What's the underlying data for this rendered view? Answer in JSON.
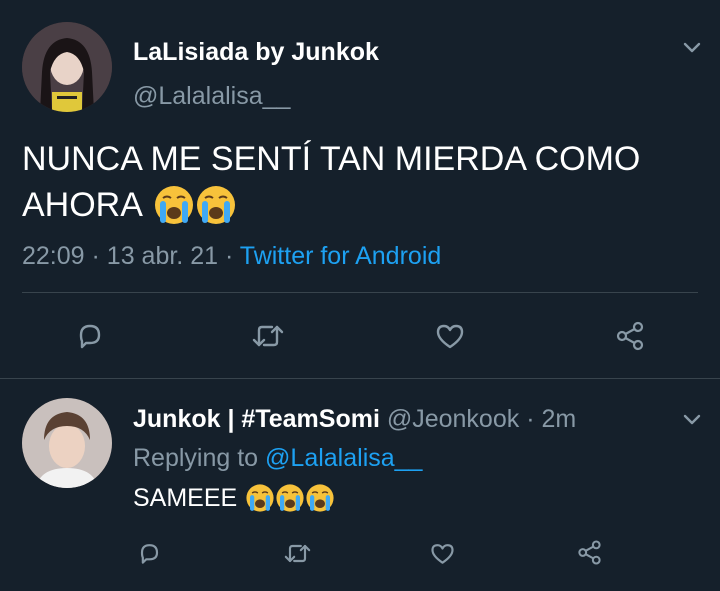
{
  "main_tweet": {
    "display_name": "LaLisiada by Junkok",
    "handle": "@Lalalalisa__",
    "text_line1": "NUNCA ME SENTÍ TAN MIERDA COMO",
    "text_line2": "AHORA",
    "time": "22:09",
    "sep1": "·",
    "date": "13 abr. 21",
    "sep2": "·",
    "source": "Twitter for Android",
    "emojis": [
      "loudly-crying-face",
      "loudly-crying-face"
    ]
  },
  "reply": {
    "display_name": "Junkok | #TeamSomi",
    "handle": "@Jeonkook",
    "sep": "·",
    "age": "2m",
    "replying_prefix": "Replying to",
    "replying_handle": "@Lalalalisa__",
    "text": "SAMEEE",
    "emojis": [
      "loudly-crying-face",
      "loudly-crying-face",
      "loudly-crying-face"
    ]
  },
  "colors": {
    "background": "#15202b",
    "secondary_text": "#8899a6",
    "accent": "#1da1f2",
    "divider": "#38444d",
    "icon": "#8899a6"
  },
  "icons": [
    "chevron-down-icon",
    "reply-icon",
    "retweet-icon",
    "like-icon",
    "share-icon"
  ]
}
